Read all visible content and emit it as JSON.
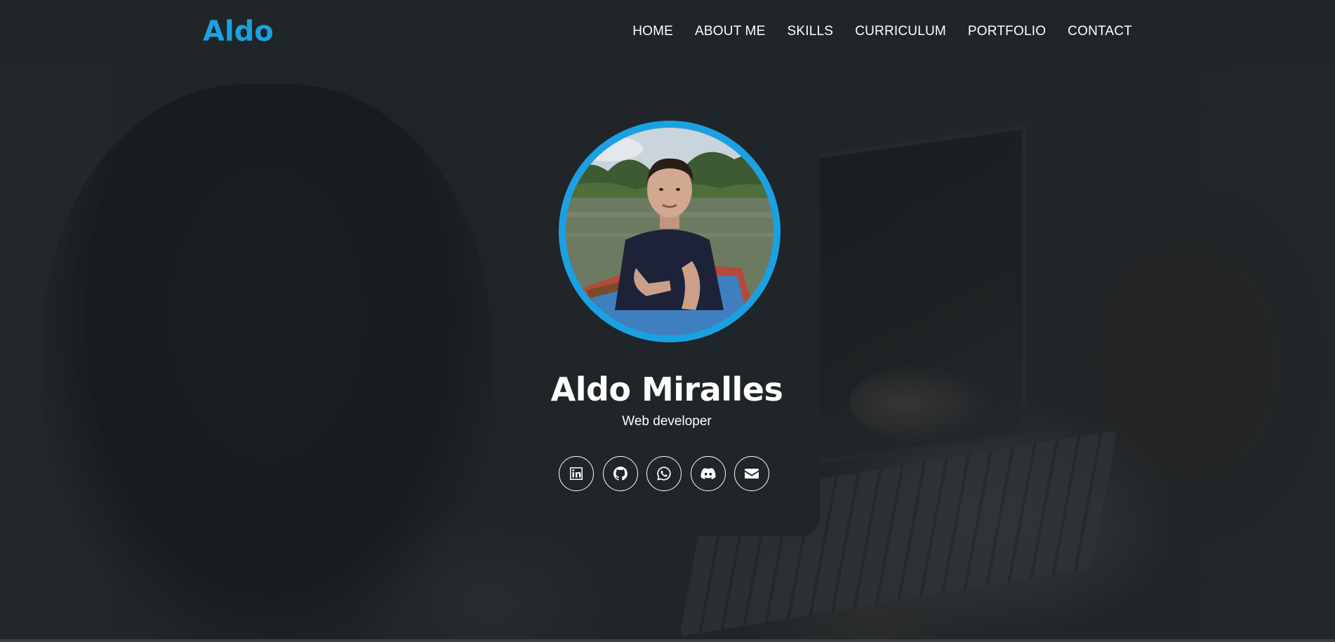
{
  "header": {
    "logo": "Aldo",
    "nav": [
      {
        "label": "HOME"
      },
      {
        "label": "ABOUT ME"
      },
      {
        "label": "SKILLS"
      },
      {
        "label": "CURRICULUM"
      },
      {
        "label": "PORTFOLIO"
      },
      {
        "label": "CONTACT"
      }
    ]
  },
  "profile": {
    "name": "Aldo Miralles",
    "role": "Web developer",
    "socials": [
      {
        "icon": "linkedin-icon"
      },
      {
        "icon": "github-icon"
      },
      {
        "icon": "whatsapp-icon"
      },
      {
        "icon": "discord-icon"
      },
      {
        "icon": "email-icon"
      }
    ]
  },
  "colors": {
    "accent": "#1ba1e2",
    "header_bg": "#1f2528",
    "card_bg": "#1f2528",
    "text": "#ffffff"
  }
}
